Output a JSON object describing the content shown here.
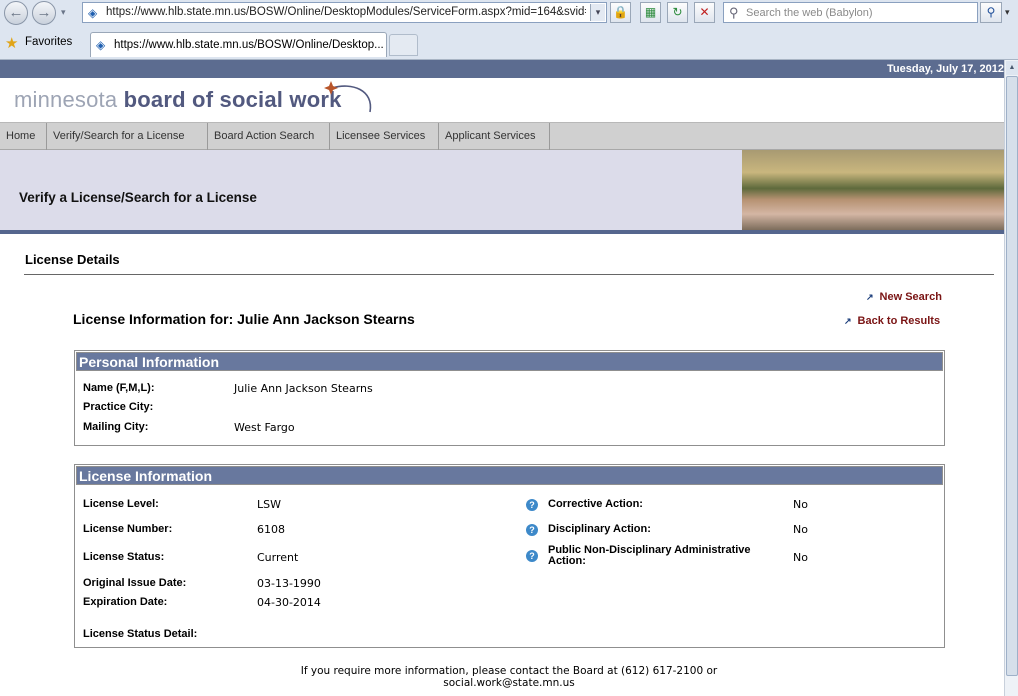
{
  "browser": {
    "url": "https://www.hlb.state.mn.us/BOSW/Online/DesktopModules/ServiceForm.aspx?mid=164&svid=21&",
    "search_placeholder": "Search the web (Babylon)",
    "favorites_label": "Favorites",
    "tab_title": "https://www.hlb.state.mn.us/BOSW/Online/Desktop..."
  },
  "site": {
    "date": "Tuesday, July 17, 2012",
    "logo_light": "minnesota",
    "logo_dark": "board of social work",
    "nav": [
      "Home",
      "Verify/Search for a License",
      "Board Action Search",
      "Licensee Services",
      "Applicant Services"
    ],
    "banner_title": "Verify a License/Search for a License"
  },
  "details": {
    "section_title": "License Details",
    "new_search": "New Search",
    "back_to_results": "Back to Results",
    "license_for": "License Information for: Julie Ann Jackson Stearns"
  },
  "personal": {
    "heading": "Personal Information",
    "rows": [
      {
        "label": "Name (F,M,L):",
        "value": "Julie Ann Jackson Stearns"
      },
      {
        "label": "Practice City:",
        "value": ""
      },
      {
        "label": "Mailing City:",
        "value": "West Fargo"
      }
    ]
  },
  "license": {
    "heading": "License Information",
    "left_rows": [
      {
        "label": "License Level:",
        "value": "LSW"
      },
      {
        "label": "License Number:",
        "value": "6108"
      },
      {
        "label": "License Status:",
        "value": "Current"
      },
      {
        "label": "Original Issue Date:",
        "value": "03-13-1990"
      },
      {
        "label": "Expiration Date:",
        "value": "04-30-2014"
      },
      {
        "label": "License Status Detail:",
        "value": ""
      }
    ],
    "right_rows": [
      {
        "label": "Corrective Action:",
        "value": "No"
      },
      {
        "label": "Disciplinary Action:",
        "value": "No"
      },
      {
        "label_line1": "Public Non-Disciplinary Administrative",
        "label_line2": "Action:",
        "value": "No"
      }
    ]
  },
  "footer": {
    "line1": "If you require more information, please contact the Board at (612) 617-2100 or",
    "line2": "social.work@state.mn.us"
  }
}
